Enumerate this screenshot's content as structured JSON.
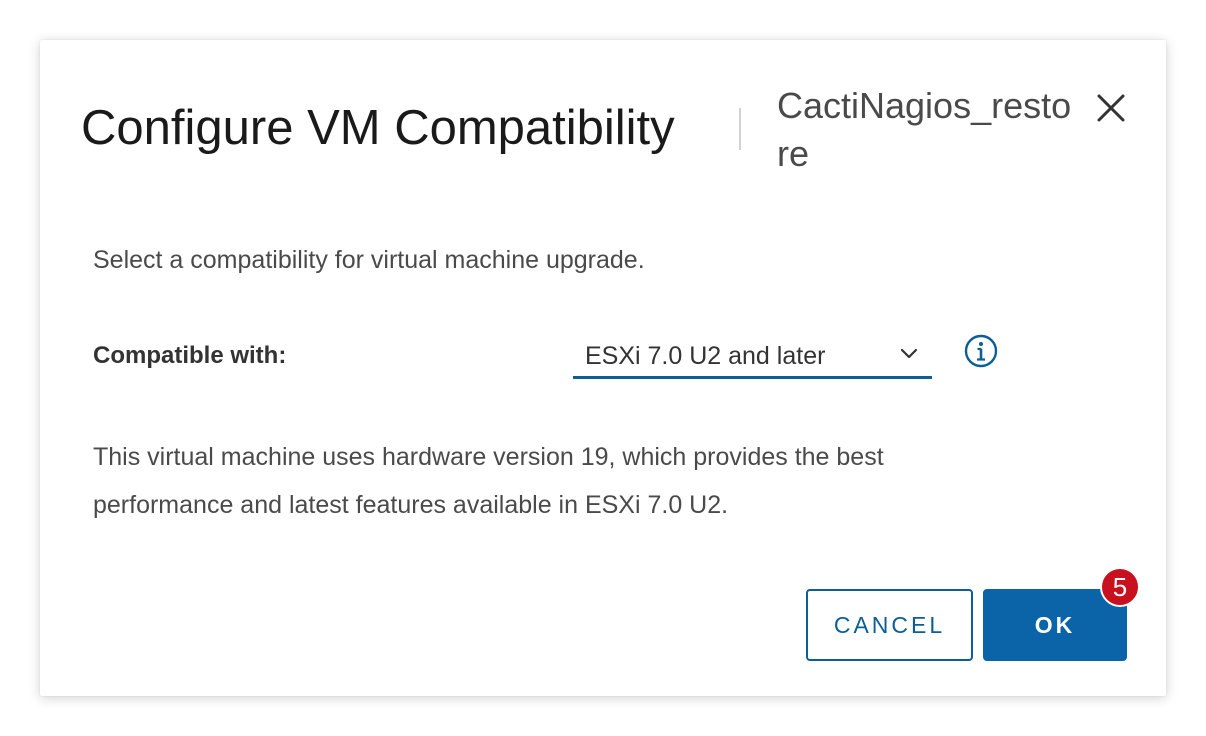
{
  "dialog": {
    "title": "Configure VM Compatibility",
    "subtitle": "CactiNagios_restore",
    "close_icon": "close-icon"
  },
  "body": {
    "intro": "Select a compatibility for virtual machine upgrade.",
    "compat_label": "Compatible with:",
    "compat_value": "ESXi 7.0 U2 and later",
    "info_icon": "info-icon",
    "description": "This virtual machine uses hardware version 19, which provides the best performance and latest features available in ESXi 7.0 U2."
  },
  "footer": {
    "cancel_label": "CANCEL",
    "ok_label": "OK",
    "step_badge": "5"
  },
  "colors": {
    "accent": "#0b63a8",
    "badge": "#c8101e"
  }
}
